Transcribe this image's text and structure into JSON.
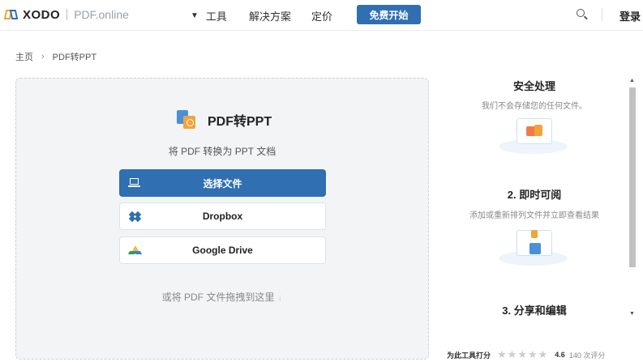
{
  "header": {
    "logo_text": "XODO",
    "logo_sub": "PDF.online",
    "nav_tools": "工具",
    "nav_solutions": "解决方案",
    "nav_pricing": "定价",
    "cta_label": "免费开始",
    "login_label": "登录"
  },
  "breadcrumb": {
    "home": "主页",
    "separator": "›",
    "current": "PDF转PPT"
  },
  "tool": {
    "title": "PDF转PPT",
    "subtitle": "将 PDF 转换为 PPT 文档",
    "select_file": "选择文件",
    "dropbox": "Dropbox",
    "gdrive": "Google Drive",
    "drag_hint": "或将 PDF 文件拖拽到这里"
  },
  "features": [
    {
      "title": "安全处理",
      "desc": "我们不会存储您的任何文件。"
    },
    {
      "title": "2. 即时可阅",
      "desc": "添加或重新排列文件并立即查看结果"
    },
    {
      "title": "3. 分享和编辑",
      "desc": ""
    }
  ],
  "rating": {
    "label": "为此工具打分",
    "stars": "★★★★★",
    "score": "4.6",
    "count": "140 次评分"
  },
  "colors": {
    "primary": "#2f6fb2",
    "accent_orange": "#f2a33a"
  },
  "icons": {
    "header": [
      "xodo-logo",
      "chevron-down-icon",
      "search-icon"
    ],
    "buttons": [
      "laptop-icon",
      "dropbox-icon",
      "google-drive-icon",
      "down-arrow-icon"
    ]
  }
}
